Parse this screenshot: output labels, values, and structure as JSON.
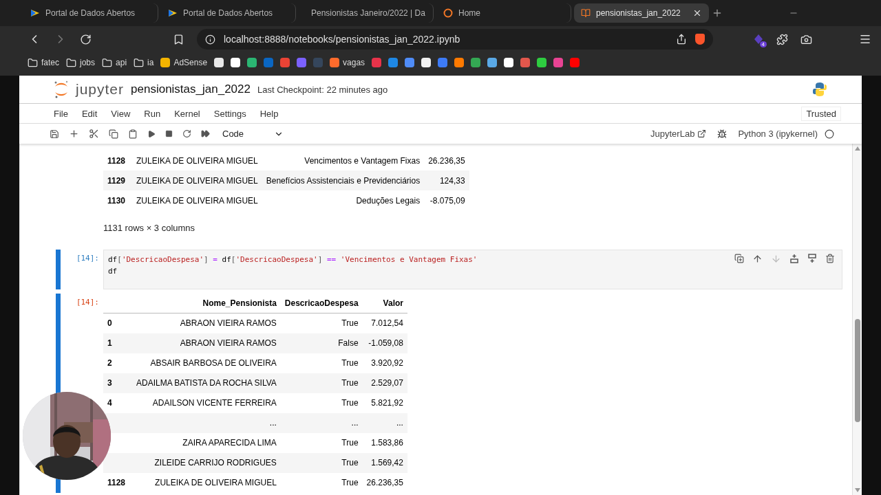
{
  "browser": {
    "tabs": [
      {
        "label": "Portal de Dados Abertos",
        "selected": false
      },
      {
        "label": "Portal de Dados Abertos",
        "selected": false
      },
      {
        "label": "Pensionistas Janeiro/2022 | Da",
        "selected": false
      },
      {
        "label": "Home",
        "selected": false
      },
      {
        "label": "pensionistas_jan_2022",
        "selected": true
      }
    ],
    "address": "localhost:8888/notebooks/pensionistas_jan_2022.ipynb",
    "extension_badge": "4",
    "bookmarks": [
      {
        "kind": "folder",
        "label": "fatec"
      },
      {
        "kind": "folder",
        "label": "jobs"
      },
      {
        "kind": "folder",
        "label": "api"
      },
      {
        "kind": "folder",
        "label": "ia"
      },
      {
        "kind": "site",
        "label": "AdSense",
        "color": "#f4b400"
      },
      {
        "kind": "site",
        "color": "#e8e8e8"
      },
      {
        "kind": "site",
        "color": "#ffffff"
      },
      {
        "kind": "site",
        "color": "#2bb673"
      },
      {
        "kind": "site",
        "color": "#0a66c2"
      },
      {
        "kind": "site",
        "color": "#ea4335"
      },
      {
        "kind": "site",
        "color": "#7b61ff"
      },
      {
        "kind": "site",
        "color": "#35465c"
      },
      {
        "kind": "site",
        "label": "vagas",
        "color": "#ff6b2c"
      },
      {
        "kind": "site",
        "color": "#e8334a"
      },
      {
        "kind": "site",
        "color": "#1e88e5"
      },
      {
        "kind": "site",
        "color": "#4f8cf7"
      },
      {
        "kind": "site",
        "color": "#f1f1f1"
      },
      {
        "kind": "site",
        "color": "#3d7bf7"
      },
      {
        "kind": "site",
        "color": "#ff7a00"
      },
      {
        "kind": "site",
        "color": "#34a853"
      },
      {
        "kind": "site",
        "color": "#5aa9e6"
      },
      {
        "kind": "site",
        "color": "#ffffff"
      },
      {
        "kind": "site",
        "color": "#e2574c"
      },
      {
        "kind": "site",
        "color": "#2ecc40"
      },
      {
        "kind": "site",
        "color": "#e84393"
      },
      {
        "kind": "site",
        "color": "#ff0000"
      }
    ]
  },
  "jupyter": {
    "logo": "jupyter",
    "title": "pensionistas_jan_2022",
    "checkpoint": "Last Checkpoint: 22 minutes ago",
    "menu": [
      "File",
      "Edit",
      "View",
      "Run",
      "Kernel",
      "Settings",
      "Help"
    ],
    "trusted": "Trusted",
    "cell_type": "Code",
    "lab_link": "JupyterLab",
    "kernel": "Python 3 (ipykernel)"
  },
  "cells": [
    {
      "kind": "table",
      "selected": false,
      "rows": [
        {
          "index": "1128",
          "cells": [
            "ZULEIKA DE OLIVEIRA MIGUEL",
            "Vencimentos e Vantagem Fixas",
            "26.236,35"
          ]
        },
        {
          "index": "1129",
          "cells": [
            "ZULEIKA DE OLIVEIRA MIGUEL",
            "Benefícios Assistenciais e Previdenciários",
            "124,33"
          ]
        },
        {
          "index": "1130",
          "cells": [
            "ZULEIKA DE OLIVEIRA MIGUEL",
            "Deduções Legais",
            "-8.075,09"
          ]
        }
      ],
      "note": "1131 rows × 3 columns"
    },
    {
      "kind": "code",
      "selected": true,
      "prompt": "[14]:",
      "lines": [
        [
          {
            "t": "df",
            "kind": "name"
          },
          {
            "t": "[",
            "kind": "punct"
          },
          {
            "t": "'DescricaoDespesa'",
            "kind": "string"
          },
          {
            "t": "]",
            "kind": "punct"
          },
          {
            "t": " = ",
            "kind": "op"
          },
          {
            "t": "df",
            "kind": "name"
          },
          {
            "t": "[",
            "kind": "punct"
          },
          {
            "t": "'DescricaoDespesa'",
            "kind": "string"
          },
          {
            "t": "]",
            "kind": "punct"
          },
          {
            "t": " == ",
            "kind": "op"
          },
          {
            "t": "'Vencimentos e Vantagem Fixas'",
            "kind": "string"
          }
        ],
        [
          {
            "t": "df",
            "kind": "name"
          }
        ]
      ]
    },
    {
      "kind": "table",
      "selected": true,
      "prompt": "[14]:",
      "columns": [
        "Nome_Pensionista",
        "DescricaoDespesa",
        "Valor"
      ],
      "rows": [
        {
          "index": "0",
          "cells": [
            "ABRAON VIEIRA RAMOS",
            "True",
            "7.012,54"
          ]
        },
        {
          "index": "1",
          "cells": [
            "ABRAON VIEIRA RAMOS",
            "False",
            "-1.059,08"
          ]
        },
        {
          "index": "2",
          "cells": [
            "ABSAIR BARBOSA DE OLIVEIRA",
            "True",
            "3.920,92"
          ]
        },
        {
          "index": "3",
          "cells": [
            "ADAILMA BATISTA DA ROCHA SILVA",
            "True",
            "2.529,07"
          ]
        },
        {
          "index": "4",
          "cells": [
            "ADAILSON VICENTE FERREIRA",
            "True",
            "5.821,92"
          ]
        },
        {
          "cells": [
            "...",
            "...",
            "..."
          ]
        },
        {
          "cells": [
            "ZAIRA APARECIDA LIMA",
            "True",
            "1.583,86"
          ]
        },
        {
          "cells": [
            "ZILEIDE CARRIJO RODRIGUES",
            "True",
            "1.569,42"
          ]
        },
        {
          "index": "1128",
          "cells": [
            "ZULEIKA DE OLIVEIRA MIGUEL",
            "True",
            "26.236,35"
          ]
        }
      ]
    }
  ]
}
